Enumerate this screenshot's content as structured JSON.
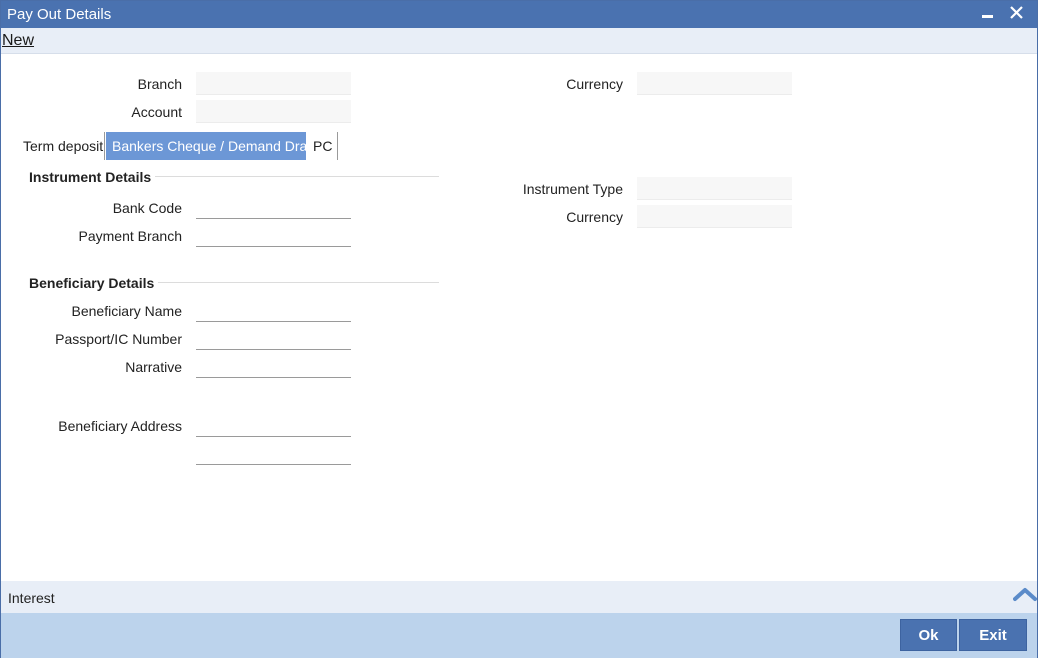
{
  "window": {
    "title": "Pay Out Details"
  },
  "menubar": {
    "new_label": "New"
  },
  "header_fields": {
    "branch": {
      "label": "Branch",
      "value": ""
    },
    "account": {
      "label": "Account",
      "value": ""
    },
    "currency": {
      "label": "Currency",
      "value": ""
    }
  },
  "tabs": [
    {
      "label": "Term deposit",
      "active": false
    },
    {
      "label": "Bankers Cheque / Demand Draft",
      "active": true
    },
    {
      "label": "PC",
      "active": false
    }
  ],
  "instrument_details": {
    "title": "Instrument Details",
    "bank_code": {
      "label": "Bank Code",
      "value": ""
    },
    "payment_branch": {
      "label": "Payment Branch",
      "value": ""
    },
    "instrument_type": {
      "label": "Instrument Type",
      "value": ""
    },
    "currency": {
      "label": "Currency",
      "value": ""
    }
  },
  "beneficiary_details": {
    "title": "Beneficiary Details",
    "name": {
      "label": "Beneficiary Name",
      "value": ""
    },
    "passport": {
      "label": "Passport/IC Number",
      "value": ""
    },
    "narrative": {
      "label": "Narrative",
      "value": ""
    },
    "address": {
      "label": "Beneficiary Address",
      "line1": "",
      "line2": ""
    }
  },
  "bottom_bar": {
    "interest_label": "Interest"
  },
  "footer": {
    "ok_label": "Ok",
    "exit_label": "Exit"
  },
  "colors": {
    "titlebar": "#4a72b0",
    "active_tab": "#6c97d6",
    "footer": "#bcd3ec",
    "button": "#4a72b0"
  }
}
